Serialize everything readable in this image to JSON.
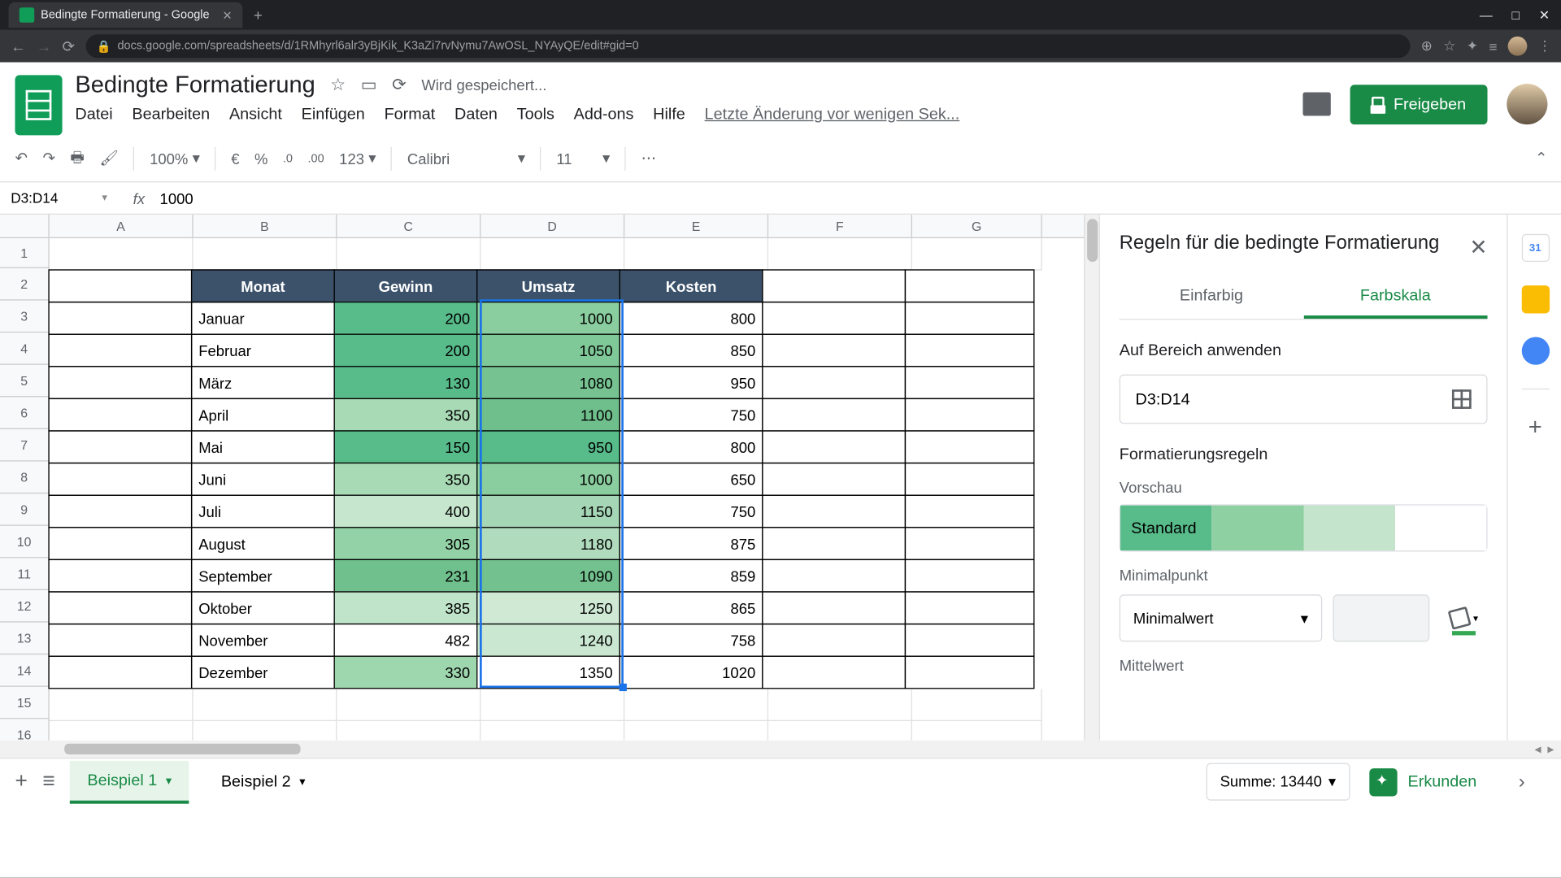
{
  "browser": {
    "tab_title": "Bedingte Formatierung - Google",
    "url": "docs.google.com/spreadsheets/d/1RMhyrl6alr3yBjKik_K3aZi7rvNymu7AwOSL_NYAyQE/edit#gid=0"
  },
  "doc": {
    "title": "Bedingte Formatierung",
    "save_status": "Wird gespeichert...",
    "share_label": "Freigeben",
    "last_edit": "Letzte Änderung vor wenigen Sek..."
  },
  "menu": {
    "file": "Datei",
    "edit": "Bearbeiten",
    "view": "Ansicht",
    "insert": "Einfügen",
    "format": "Format",
    "data": "Daten",
    "tools": "Tools",
    "addons": "Add-ons",
    "help": "Hilfe"
  },
  "toolbar": {
    "zoom": "100%",
    "currency": "€",
    "percent": "%",
    "dec_less": ".0",
    "dec_more": ".00",
    "fmt": "123",
    "font": "Calibri",
    "size": "11",
    "more": "⋯"
  },
  "namebox": "D3:D14",
  "formula": "1000",
  "columns": [
    "A",
    "B",
    "C",
    "D",
    "E",
    "F",
    "G"
  ],
  "rows": [
    "1",
    "2",
    "3",
    "4",
    "5",
    "6",
    "7",
    "8",
    "9",
    "10",
    "11",
    "12",
    "13",
    "14",
    "15",
    "16"
  ],
  "headers": {
    "b": "Monat",
    "c": "Gewinn",
    "d": "Umsatz",
    "e": "Kosten"
  },
  "data": [
    {
      "m": "Januar",
      "g": "200",
      "u": "1000",
      "k": "800",
      "gc": "#57bb8a",
      "uc": "#8ace9f"
    },
    {
      "m": "Februar",
      "g": "200",
      "u": "1050",
      "k": "850",
      "gc": "#57bb8a",
      "uc": "#7fc898"
    },
    {
      "m": "März",
      "g": "130",
      "u": "1080",
      "k": "950",
      "gc": "#57bb8a",
      "uc": "#76c391"
    },
    {
      "m": "April",
      "g": "350",
      "u": "1100",
      "k": "750",
      "gc": "#a8dab5",
      "uc": "#6fbf8c"
    },
    {
      "m": "Mai",
      "g": "150",
      "u": "950",
      "k": "800",
      "gc": "#57bb8a",
      "uc": "#57bb8a"
    },
    {
      "m": "Juni",
      "g": "350",
      "u": "1000",
      "k": "650",
      "gc": "#a8dab5",
      "uc": "#8ace9f"
    },
    {
      "m": "Juli",
      "g": "400",
      "u": "1150",
      "k": "750",
      "gc": "#c6e7ce",
      "uc": "#a5d6b5"
    },
    {
      "m": "August",
      "g": "305",
      "u": "1180",
      "k": "875",
      "gc": "#92d2a6",
      "uc": "#b0dcbd"
    },
    {
      "m": "September",
      "g": "231",
      "u": "1090",
      "k": "859",
      "gc": "#6fc08c",
      "uc": "#72c18e"
    },
    {
      "m": "Oktober",
      "g": "385",
      "u": "1250",
      "k": "865",
      "gc": "#c0e4c9",
      "uc": "#cfe9d5"
    },
    {
      "m": "November",
      "g": "482",
      "u": "1240",
      "k": "758",
      "gc": "#ffffff",
      "uc": "#cae7d1"
    },
    {
      "m": "Dezember",
      "g": "330",
      "u": "1350",
      "k": "1020",
      "gc": "#9ed6ae",
      "uc": "#ffffff"
    }
  ],
  "sidebar": {
    "title": "Regeln für die bedingte Formatierung",
    "tab_single": "Einfarbig",
    "tab_scale": "Farbskala",
    "apply_range_label": "Auf Bereich anwenden",
    "range_value": "D3:D14",
    "rules_label": "Formatierungsregeln",
    "preview_label": "Vorschau",
    "preview_text": "Standard",
    "min_label": "Minimalpunkt",
    "min_select": "Minimalwert",
    "mid_label": "Mittelwert",
    "preview_colors": [
      "#57bb8a",
      "#8fd0a3",
      "#c4e5cc",
      "#ffffff"
    ]
  },
  "sheets": {
    "add": "+",
    "menu": "≡",
    "tab1": "Beispiel 1",
    "tab2": "Beispiel 2",
    "sum": "Summe: 13440",
    "explore": "Erkunden"
  }
}
